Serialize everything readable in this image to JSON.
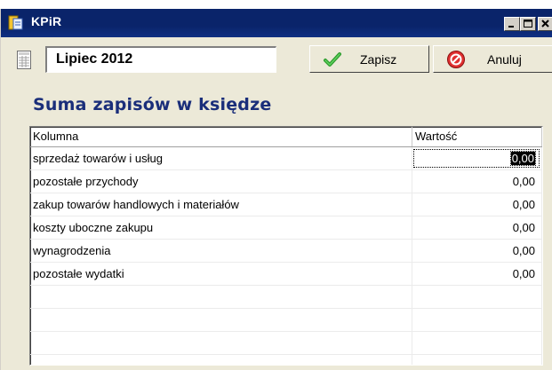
{
  "window": {
    "title": "KPiR",
    "title_bg": "#0a246a",
    "icons": [
      "app-icon",
      "minimize-icon",
      "maximize-icon",
      "close-icon"
    ]
  },
  "toolbar": {
    "period": "Lipiec 2012",
    "save_label": "Zapisz",
    "cancel_label": "Anuluj",
    "icons": [
      "document-icon",
      "checkmark-icon",
      "cancel-icon"
    ]
  },
  "section": {
    "title": "Suma zapisów w księdze",
    "title_color": "#1a2e7a"
  },
  "grid": {
    "columns": [
      "Kolumna",
      "Wartość"
    ],
    "rows": [
      {
        "name": "sprzedaż towarów i usług",
        "value": "0,00"
      },
      {
        "name": "pozostałe przychody",
        "value": "0,00"
      },
      {
        "name": "zakup towarów handlowych i materiałów",
        "value": "0,00"
      },
      {
        "name": "koszty uboczne zakupu",
        "value": "0,00"
      },
      {
        "name": "wynagrodzenia",
        "value": "0,00"
      },
      {
        "name": "pozostałe wydatki",
        "value": "0,00"
      }
    ]
  }
}
